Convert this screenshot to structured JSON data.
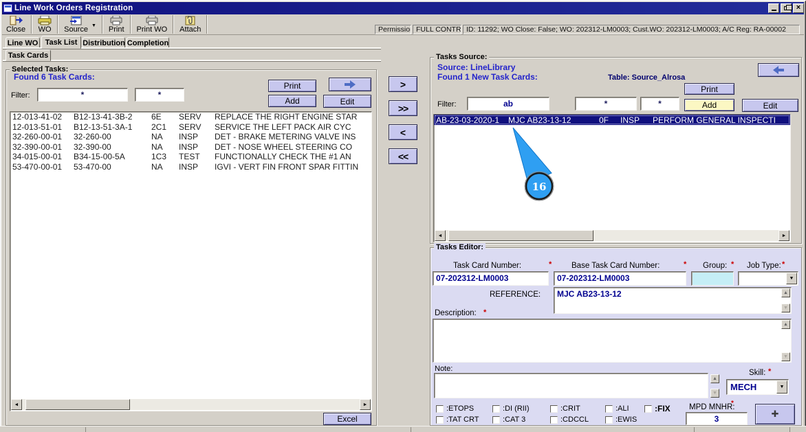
{
  "window": {
    "title": "Line Work Orders Registration"
  },
  "toolbar": {
    "buttons": [
      {
        "label": "Close"
      },
      {
        "label": "WO"
      },
      {
        "label": "Source"
      },
      {
        "label": "Print"
      },
      {
        "label": "Print WO"
      },
      {
        "label": "Attach"
      }
    ],
    "permission_label": "Permission:",
    "permission_value": "FULL CONTROL",
    "context_info": "ID: 11292; WO Close: False; WO: 202312-LM0003; Cust.WO: 202312-LM0003; A/C Reg: RA-00002"
  },
  "tabs": {
    "items": [
      "Line WO",
      "Task List",
      "Distribution",
      "Completion"
    ],
    "active": "Task List",
    "subtab": "Task Cards"
  },
  "selected_tasks": {
    "legend": "Selected Tasks:",
    "found": "Found 6 Task Cards:",
    "filter_label": "Filter:",
    "filter1": "*",
    "filter2": "*",
    "print": "Print",
    "add": "Add",
    "edit": "Edit",
    "excel": "Excel",
    "rows": [
      [
        "12-013-41-02",
        "B12-13-41-3B-2",
        "6E",
        "SERV",
        "REPLACE THE RIGHT ENGINE STAR"
      ],
      [
        "12-013-51-01",
        "B12-13-51-3A-1",
        "2C1",
        "SERV",
        "SERVICE THE LEFT PACK AIR CYC"
      ],
      [
        "32-260-00-01",
        "32-260-00",
        "NA",
        "INSP",
        "DET - BRAKE METERING VALVE INS"
      ],
      [
        "32-390-00-01",
        "32-390-00",
        "NA",
        "INSP",
        "DET - NOSE WHEEL STEERING CO"
      ],
      [
        "34-015-00-01",
        "B34-15-00-5A",
        "1C3",
        "TEST",
        "FUNCTIONALLY CHECK THE  #1 AN"
      ],
      [
        "53-470-00-01",
        "53-470-00",
        "NA",
        "INSP",
        "IGVI - VERT FIN FRONT SPAR FITTIN"
      ]
    ]
  },
  "transfer": {
    "right": ">",
    "right_all": ">>",
    "left": "<",
    "left_all": "<<"
  },
  "tasks_source": {
    "legend": "Tasks Source:",
    "source_line": "Source: LineLibrary",
    "found_line": "Found 1 New Task Cards:",
    "table_label": "Table: Source_Alrosa",
    "filter_label": "Filter:",
    "filter1": "ab",
    "filter2": "*",
    "filter3": "*",
    "print": "Print",
    "add": "Add",
    "edit": "Edit",
    "selected_row": [
      "AB-23-03-2020-1",
      "MJC AB23-13-12",
      "0F",
      "INSP",
      "PERFORM GENERAL INSPECTI"
    ]
  },
  "tasks_editor": {
    "legend": "Tasks Editor:",
    "task_card_label": "Task Card Number:",
    "task_card_value": "07-202312-LM0003",
    "base_label": "Base Task Card Number:",
    "base_value": "07-202312-LM0003",
    "group_label": "Group:",
    "job_type_label": "Job Type:",
    "reference_label": "REFERENCE:",
    "reference_value": "MJC AB23-13-12",
    "description_label": "Description:",
    "note_label": "Note:",
    "skill_label": "Skill:",
    "skill_value": "MECH",
    "mpd_label": "MPD MNHR:",
    "mpd_value": "3",
    "required_marker": "*",
    "checkboxes_row1": [
      ":ETOPS",
      ":DI (RII)",
      ":CRIT",
      ":ALI",
      ":FIX"
    ],
    "checkboxes_row2": [
      ":TAT CRT",
      ":CAT 3",
      ":CDCCL",
      ":EWIS"
    ]
  },
  "callout": {
    "number": "16",
    "color": "#2f9ff2"
  },
  "colors": {
    "button_accent": "#c7c7ee",
    "add_highlight": "#fbf7c3",
    "selection": "#10107e",
    "info_text": "#2323cb",
    "value_text": "#00008f",
    "required": "#cc0000",
    "editor_bg": "#dbdbf2",
    "group_field_bg": "#c5eef6",
    "titlebar": "#10117f"
  },
  "icons": {
    "up": "▲",
    "down": "▼",
    "left": "◄",
    "right": "►",
    "caret": "▼",
    "plus": "✚",
    "minimize": "_",
    "close_x": "×"
  }
}
